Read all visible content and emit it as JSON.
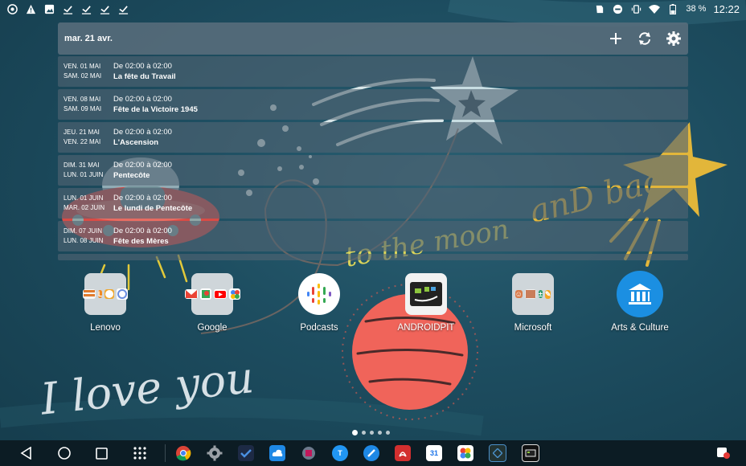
{
  "status_bar": {
    "left_icons": [
      "chrome-icon",
      "alert-icon",
      "image-icon",
      "check-icon",
      "check-icon",
      "check-icon",
      "check-icon"
    ],
    "right_icons": [
      "nfc-icon",
      "do-not-disturb-icon",
      "vibrate-icon",
      "wifi-icon"
    ],
    "battery": "38 %",
    "time": "12:22"
  },
  "calendar": {
    "date": "mar. 21 avr.",
    "events": [
      {
        "start": "VEN. 01 MAI",
        "end": "SAM. 02 MAI",
        "time": "De 02:00 à 02:00",
        "title": "La fête du Travail"
      },
      {
        "start": "VEN. 08 MAI",
        "end": "SAM. 09 MAI",
        "time": "De 02:00 à 02:00",
        "title": "Fête de la Victoire 1945"
      },
      {
        "start": "JEU. 21 MAI",
        "end": "VEN. 22 MAI",
        "time": "De 02:00 à 02:00",
        "title": "L'Ascension"
      },
      {
        "start": "DIM. 31 MAI",
        "end": "LUN. 01 JUIN",
        "time": "De 02:00 à 02:00",
        "title": "Pentecôte"
      },
      {
        "start": "LUN. 01 JUIN",
        "end": "MAR. 02 JUIN",
        "time": "De 02:00 à 02:00",
        "title": "Le lundi de Pentecôte"
      },
      {
        "start": "DIM. 07 JUIN",
        "end": "LUN. 08 JUIN",
        "time": "De 02:00 à 02:00",
        "title": "Fête des Mères"
      }
    ]
  },
  "home_apps": [
    {
      "label": "Lenovo",
      "icon": "lenovo-folder-icon"
    },
    {
      "label": "Google",
      "icon": "google-folder-icon"
    },
    {
      "label": "Podcasts",
      "icon": "podcasts-icon"
    },
    {
      "label": "ANDROIDPIT",
      "icon": "androidpit-icon"
    },
    {
      "label": "Microsoft",
      "icon": "microsoft-folder-icon"
    },
    {
      "label": "Arts & Culture",
      "icon": "arts-culture-icon"
    }
  ],
  "wallpaper_text": [
    "I love you",
    "to the moon",
    "anD back"
  ],
  "page_indicator": {
    "count": 5,
    "active": 0
  },
  "colors": {
    "background": "#1d4d60",
    "widget_row": "#506473",
    "navbar": "#0c1c24",
    "planet": "#f0645a",
    "star": "#e2b63a"
  }
}
